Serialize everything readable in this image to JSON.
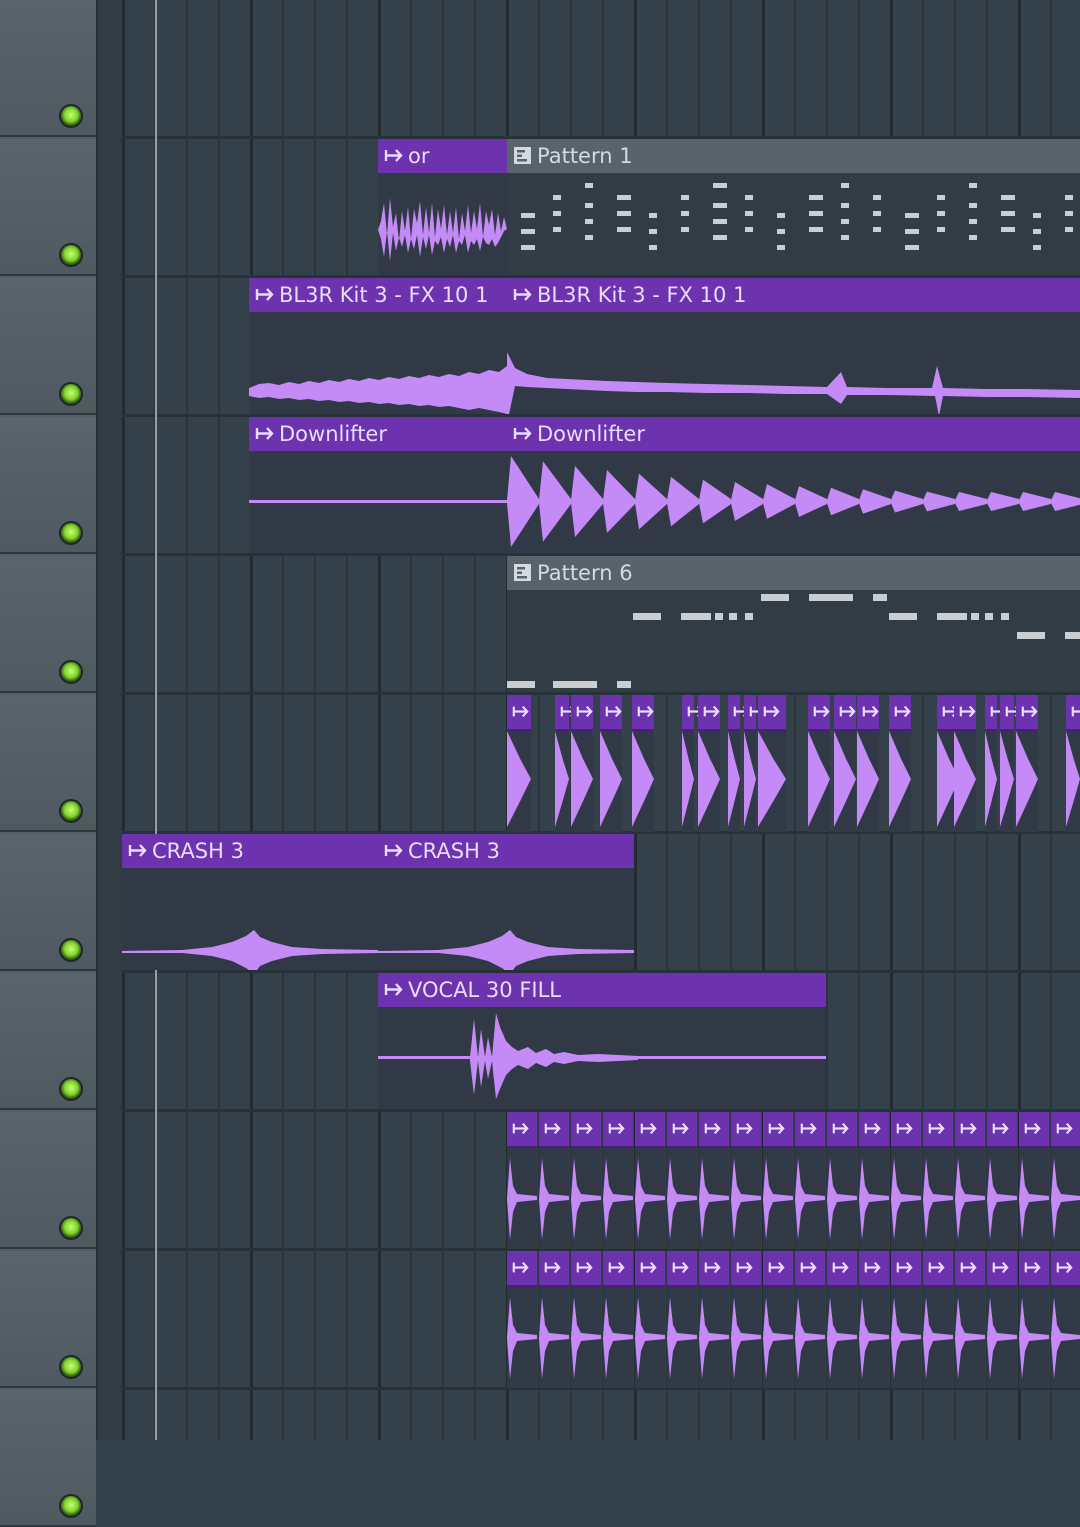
{
  "playlist": {
    "tracks": [
      "track-1",
      "track-2",
      "track-3",
      "track-4",
      "track-5",
      "track-6",
      "track-7",
      "track-8",
      "track-9",
      "track-10",
      "track-11"
    ],
    "clips": {
      "or": "or",
      "pattern1": "Pattern 1",
      "fx1": "BL3R Kit 3 - FX 10 1",
      "fx2": "BL3R Kit 3 - FX 10 1",
      "down1": "Downlifter",
      "down2": "Downlifter",
      "pattern6": "Pattern 6",
      "crash1": "CRASH 3",
      "crash2": "CRASH 3",
      "vocal": "VOCAL 30 FILL"
    }
  },
  "colors": {
    "audio_header": "#6d32ae",
    "waveform": "#c48af5",
    "pattern_header": "#59636b",
    "grid_bg": "#34414b",
    "led": "#7fd22a"
  },
  "icons": {
    "audio_clip": "audio-clip-icon",
    "pattern_clip": "pattern-clip-icon",
    "mute_led": "track-mute-led-icon"
  }
}
